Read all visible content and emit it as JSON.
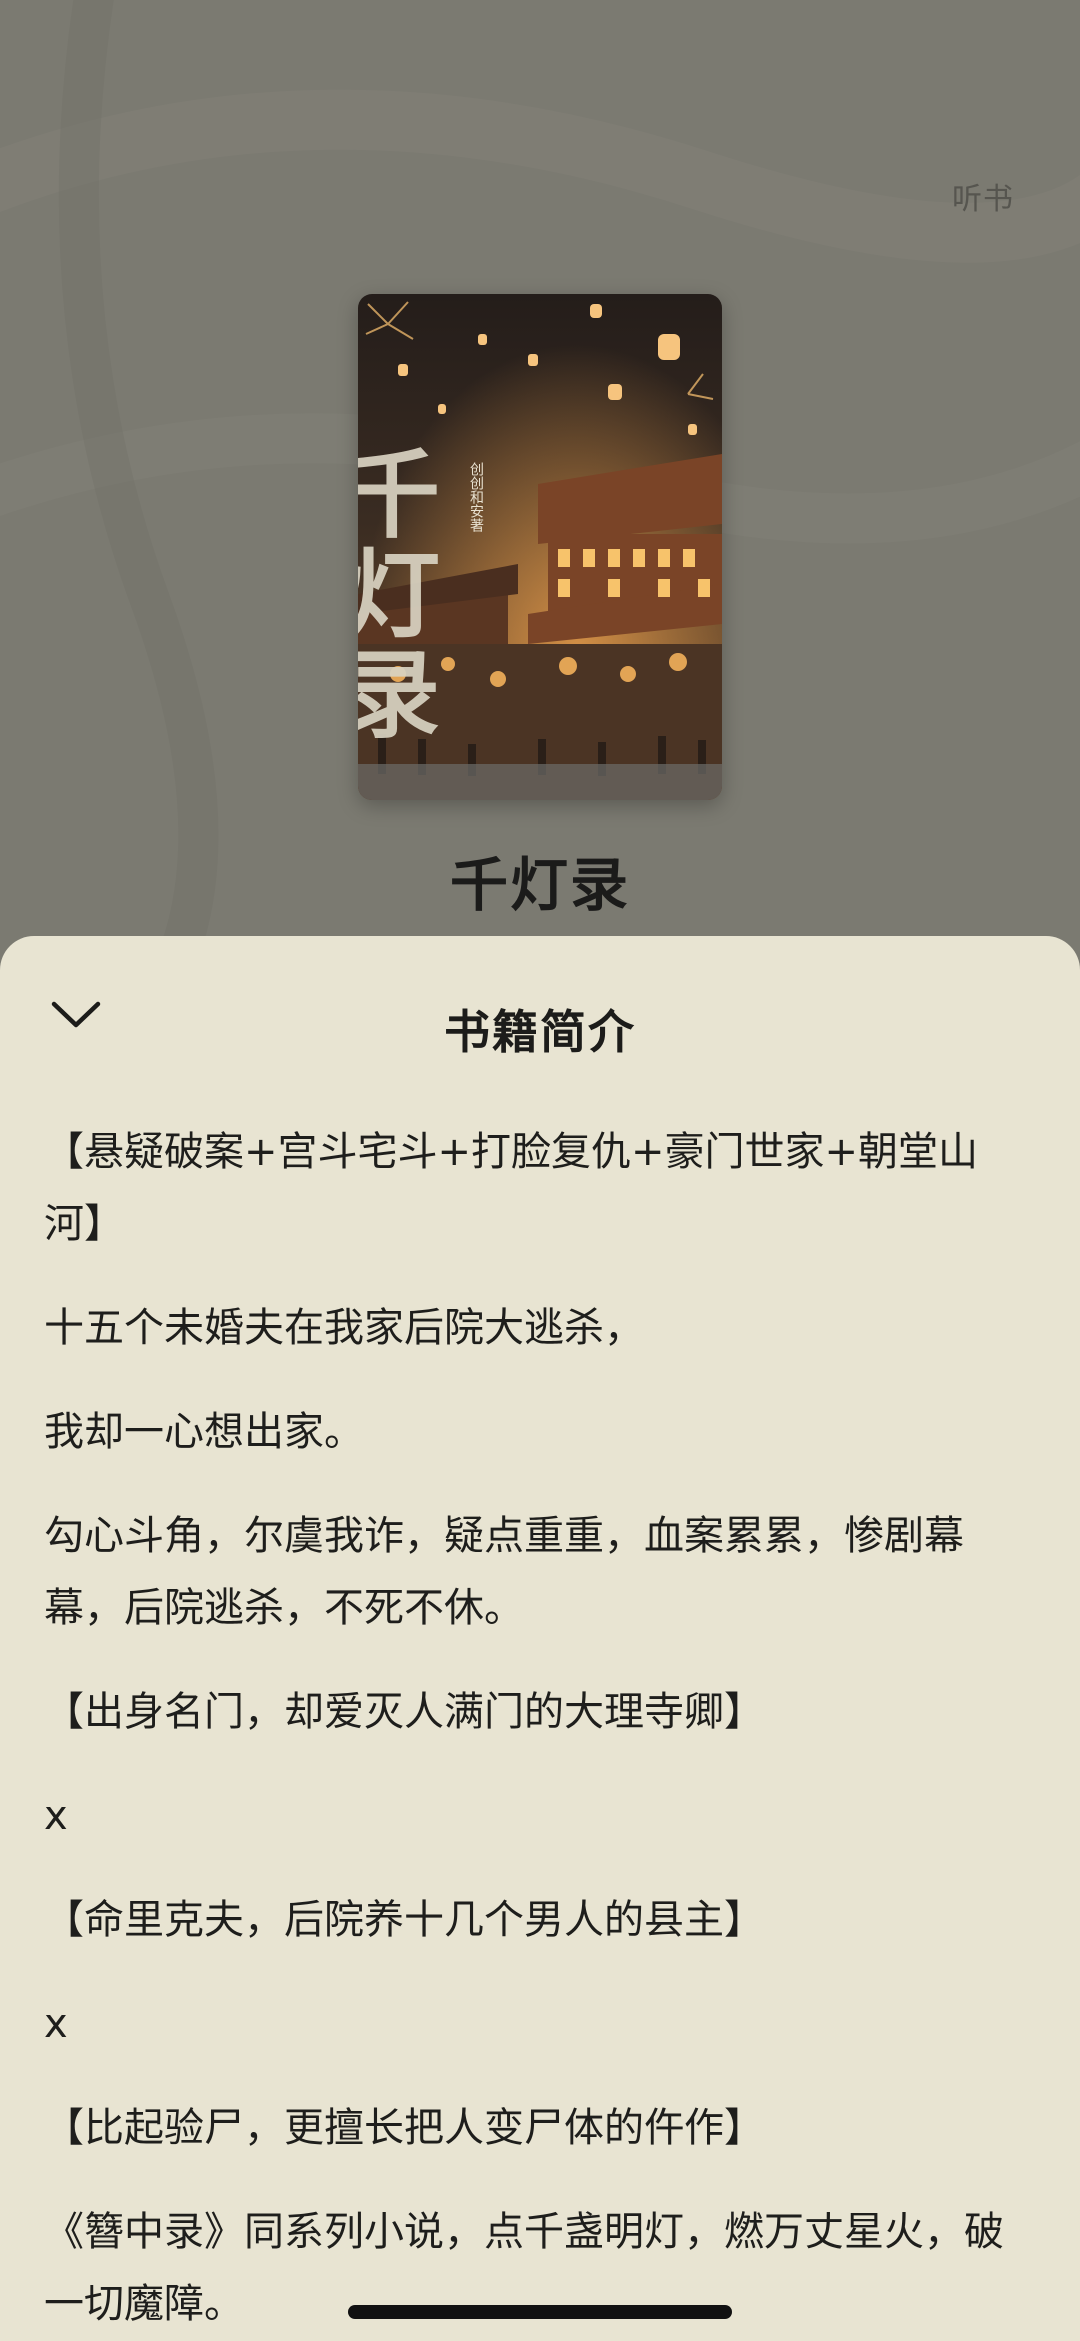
{
  "header": {
    "listen_label": "听书"
  },
  "book": {
    "title": "千灯录",
    "cover": {
      "title_art": "千灯录",
      "author_art": "创创和安著"
    }
  },
  "sheet": {
    "title": "书籍简介",
    "close_icon": "chevron-down-icon"
  },
  "description": {
    "paragraphs": [
      "【悬疑破案+宫斗宅斗+打脸复仇+豪门世家+朝堂山河】",
      "十五个未婚夫在我家后院大逃杀，",
      "我却一心想出家。",
      "勾心斗角，尔虞我诈，疑点重重，血案累累，惨剧幕幕，后院逃杀，不死不休。",
      "【出身名门，却爱灭人满门的大理寺卿】",
      "x",
      "【命里克夫，后院养十几个男人的县主】",
      "x",
      "【比起验尸，更擅长把人变尸体的仵作】",
      "《簪中录》同系列小说，点千盏明灯，燃万丈星火，破一切魔障。"
    ]
  },
  "colors": {
    "background": "#7b7a71",
    "sheet": "#e8e4d2",
    "text": "#1e1e1c"
  }
}
